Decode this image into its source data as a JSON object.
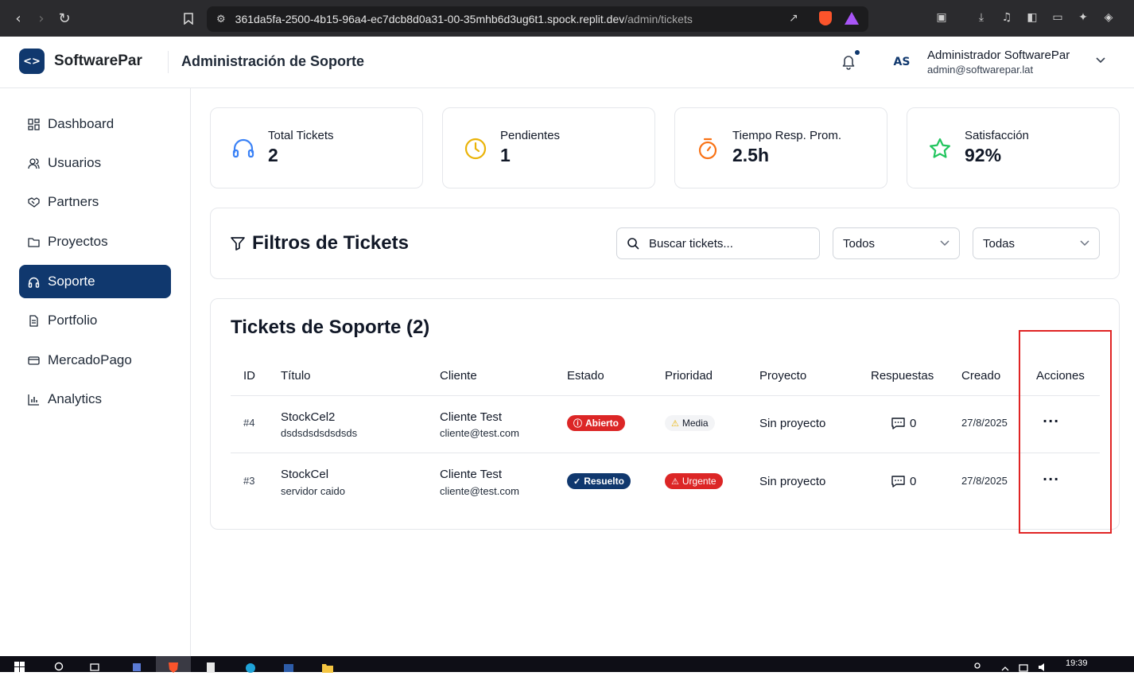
{
  "browser": {
    "url_host": "361da5fa-2500-4b15-96a4-ec7dcb8d0a31-00-35mhb6d3ug6t1.spock.replit.dev",
    "url_path": "/admin/tickets"
  },
  "header": {
    "logo_glyph": "<>",
    "brand": "SoftwarePar",
    "title": "Administración de Soporte",
    "avatar_initials": "AS",
    "user_name": "Administrador SoftwarePar",
    "user_email": "admin@softwarepar.lat"
  },
  "sidebar": {
    "items": [
      {
        "label": "Dashboard",
        "icon": "grid-icon"
      },
      {
        "label": "Usuarios",
        "icon": "users-icon"
      },
      {
        "label": "Partners",
        "icon": "handshake-icon"
      },
      {
        "label": "Proyectos",
        "icon": "folder-icon"
      },
      {
        "label": "Soporte",
        "icon": "headphones-icon",
        "active": true
      },
      {
        "label": "Portfolio",
        "icon": "document-icon"
      },
      {
        "label": "MercadoPago",
        "icon": "credit-card-icon"
      },
      {
        "label": "Analytics",
        "icon": "bar-chart-icon"
      }
    ]
  },
  "stats": [
    {
      "label": "Total Tickets",
      "value": "2",
      "icon": "headphones-icon",
      "color": "#3b82f6"
    },
    {
      "label": "Pendientes",
      "value": "1",
      "icon": "clock-icon",
      "color": "#eab308"
    },
    {
      "label": "Tiempo Resp. Prom.",
      "value": "2.5h",
      "icon": "timer-icon",
      "color": "#f97316"
    },
    {
      "label": "Satisfacción",
      "value": "92%",
      "icon": "star-icon",
      "color": "#22c55e"
    }
  ],
  "filters": {
    "title": "Filtros de Tickets",
    "search_placeholder": "Buscar tickets...",
    "status_selected": "Todos",
    "priority_selected": "Todas"
  },
  "tickets": {
    "title": "Tickets de Soporte (2)",
    "columns": [
      "ID",
      "Título",
      "Cliente",
      "Estado",
      "Prioridad",
      "Proyecto",
      "Respuestas",
      "Creado",
      "Acciones"
    ],
    "rows": [
      {
        "id": "#4",
        "title": "StockCel2",
        "description": "dsdsdsdsdsdsds",
        "client_name": "Cliente Test",
        "client_email": "cliente@test.com",
        "status": "Abierto",
        "status_color": "#dc2626",
        "priority": "Media",
        "priority_color": "#f3f4f6",
        "project": "Sin proyecto",
        "responses": "0",
        "created": "27/8/2025"
      },
      {
        "id": "#3",
        "title": "StockCel",
        "description": "servidor caido",
        "client_name": "Cliente Test",
        "client_email": "cliente@test.com",
        "status": "Resuelto",
        "status_color": "#10386e",
        "priority": "Urgente",
        "priority_color": "#dc2626",
        "project": "Sin proyecto",
        "responses": "0",
        "created": "27/8/2025"
      }
    ]
  },
  "taskbar": {
    "time": "19:39"
  }
}
